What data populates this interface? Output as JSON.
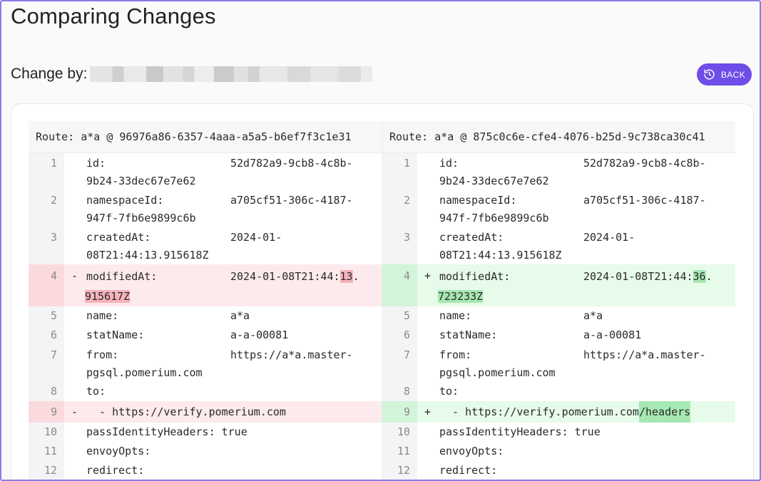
{
  "page": {
    "title": "Comparing Changes"
  },
  "change_by": {
    "label": "Change by:"
  },
  "back_button": {
    "label": "BACK",
    "icon": "history-icon"
  },
  "diff": {
    "left_header": "Route: a*a @ 96976a86-6357-4aaa-a5a5-b6ef7f3c1e31",
    "right_header": "Route: a*a @ 875c0c6e-cfe4-4076-b25d-9c738ca30c41",
    "rows": {
      "r1": {
        "num": "1",
        "key_l": "id:",
        "val_l1": "52d782a9-9cb8-4c8b-",
        "val_l2": "9b24-33dec67e7e62",
        "key_r": "id:",
        "val_r1": "52d782a9-9cb8-4c8b-",
        "val_r2": "9b24-33dec67e7e62"
      },
      "r2": {
        "num": "2",
        "key_l": "namespaceId:",
        "val_l1": "a705cf51-306c-4187-",
        "val_l2": "947f-7fb6e9899c6b",
        "key_r": "namespaceId:",
        "val_r1": "a705cf51-306c-4187-",
        "val_r2": "947f-7fb6e9899c6b"
      },
      "r3": {
        "num": "3",
        "key_l": "createdAt:",
        "val_l1": "2024-01-",
        "val_l2": "08T21:44:13.915618Z",
        "key_r": "createdAt:",
        "val_r1": "2024-01-",
        "val_r2": "08T21:44:13.915618Z"
      },
      "r4": {
        "num": "4",
        "sign_l": "-",
        "sign_r": "+",
        "key_l": "modifiedAt:",
        "val_l_pre": "2024-01-08T21:44:",
        "val_l_hl": "13",
        "val_l_dot": ".",
        "val_l2": "915617Z",
        "key_r": "modifiedAt:",
        "val_r_pre": "2024-01-08T21:44:",
        "val_r_hl": "36",
        "val_r_dot": ".",
        "val_r2": "723233Z"
      },
      "r5": {
        "num": "5",
        "key": "name:",
        "val": "a*a"
      },
      "r6": {
        "num": "6",
        "key": "statName:",
        "val": "a-a-00081"
      },
      "r7": {
        "num": "7",
        "key": "from:",
        "val1": "https://a*a.master-",
        "val2": "pgsql.pomerium.com"
      },
      "r8": {
        "num": "8",
        "key": "to:"
      },
      "r9": {
        "num": "9",
        "sign_l": "-",
        "sign_r": "+",
        "text": "  - https://verify.pomerium.com",
        "added": "/headers"
      },
      "r10": {
        "num": "10",
        "key": "passIdentityHeaders:",
        "val": "true"
      },
      "r11": {
        "num": "11",
        "key": "envoyOpts:"
      },
      "r12": {
        "num": "12",
        "key": "redirect:"
      }
    }
  },
  "colors": {
    "accent": "#6e4de8",
    "deleted_bg": "#fdeaec",
    "deleted_hl": "#f6b3ba",
    "inserted_bg": "#e6fbe9",
    "inserted_hl": "#a6e8b2"
  }
}
